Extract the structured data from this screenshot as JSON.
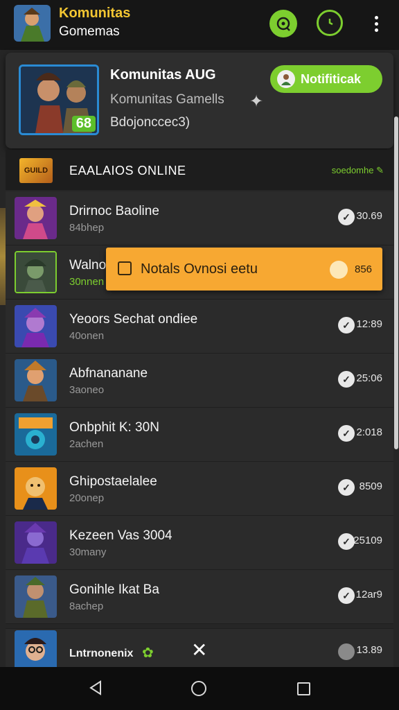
{
  "app": {
    "title": "Komunitas",
    "subtitle": "Gomemas",
    "icons": {
      "chat": "chat-icon",
      "clock": "clock-icon",
      "more": "more-vertical-icon"
    }
  },
  "hero": {
    "title": "Komunitas AUG",
    "subtitle": "Komunitas Gamells",
    "status": "Bdojonccec3)",
    "badge": "68",
    "notify_label": "Notifiticak",
    "accent": "#7dce2f"
  },
  "section": {
    "title": "EAALAIOS ONLINE",
    "link": "soedomhe",
    "icon_text": "GUILD"
  },
  "rows": [
    {
      "name": "Drirnoc Baoline",
      "sub": "84bhep",
      "time": "30.69"
    },
    {
      "name": "Walno",
      "sub": "30nnen",
      "time": "856"
    },
    {
      "name": "Yeoors Sechat ondiee",
      "sub": "40onen",
      "time": "12:89"
    },
    {
      "name": "Abfnananane",
      "sub": "3aoneo",
      "time": "25:06"
    },
    {
      "name": "Onbphit K: 30N",
      "sub": "2achen",
      "time": "2:018"
    },
    {
      "name": "Ghipostaelalee",
      "sub": "20onep",
      "time": "8509"
    },
    {
      "name": "Kezeen Vas 3004",
      "sub": "30many",
      "time": "25109"
    },
    {
      "name": "Gonihle Ikat Ba",
      "sub": "8achep",
      "time": "12ar9"
    }
  ],
  "toast": {
    "text": "Notals Ovnosi eetu",
    "time": "856",
    "color": "#f7a832"
  },
  "last_row": {
    "name": "Lntrnonenix",
    "time": "13.89"
  },
  "nav": {
    "back": "back-icon",
    "home": "home-icon",
    "recent": "recent-apps-icon"
  }
}
